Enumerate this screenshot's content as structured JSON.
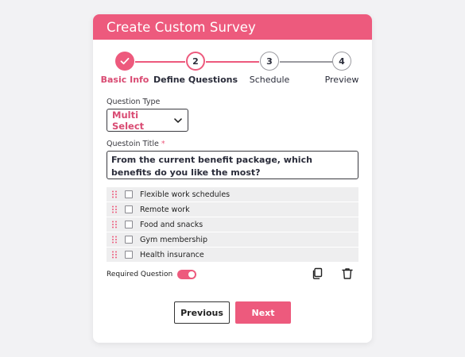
{
  "survey": {
    "title": "Create Custom Survey",
    "steps": [
      {
        "number": "1",
        "label": "Basic Info",
        "state": "completed"
      },
      {
        "number": "2",
        "label": "Define Questions",
        "state": "active"
      },
      {
        "number": "3",
        "label": "Schedule",
        "state": "pending"
      },
      {
        "number": "4",
        "label": "Preview",
        "state": "pending"
      }
    ],
    "question_type": {
      "label": "Question Type",
      "value": "Multi Select"
    },
    "question_title": {
      "label": "Questoin Title",
      "required_mark": "*",
      "value": "From the current benefit package, which benefits do you like the most?"
    },
    "options": [
      {
        "label": "Flexible work schedules",
        "checked": false
      },
      {
        "label": "Remote work",
        "checked": false
      },
      {
        "label": "Food and snacks",
        "checked": false
      },
      {
        "label": "Gym membership",
        "checked": false
      },
      {
        "label": "Health insurance",
        "checked": false
      }
    ],
    "required": {
      "label": "Required Question",
      "on": true
    },
    "buttons": {
      "previous": "Previous",
      "next": "Next"
    }
  },
  "colors": {
    "accent": "#ed5a7d",
    "accent_text": "#d94a72",
    "step_pending": "#9a9aa0",
    "text_dark": "#2a2c3a"
  },
  "icons": {
    "step1": "check-icon",
    "select": "chevron-down-icon",
    "drag": "drag-handle-icon",
    "copy": "copy-icon",
    "delete": "trash-icon"
  }
}
